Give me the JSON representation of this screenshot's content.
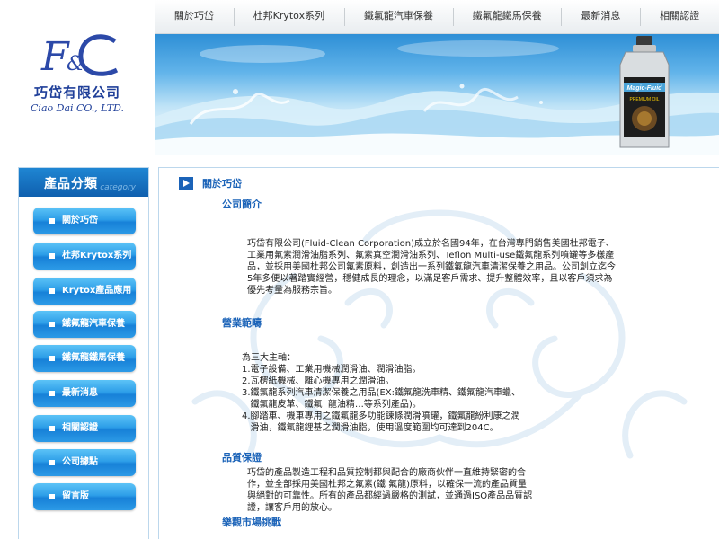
{
  "brand": {
    "logo_text": "F&C",
    "company_name": "巧岱有限公司",
    "company_name_en": "Ciao Dai CO., LTD."
  },
  "top_nav": [
    {
      "label": "關於巧岱"
    },
    {
      "label": "杜邦Krytox系列"
    },
    {
      "label": "鐵氟龍汽車保養"
    },
    {
      "label": "鐵氟龍鐵馬保養"
    },
    {
      "label": "最新消息"
    },
    {
      "label": "相關認證"
    }
  ],
  "banner": {
    "product_label": "Magic-Fluid",
    "product_sub": "PREMIUM OIL"
  },
  "sidebar": {
    "title": "產品分類",
    "subtitle": "category",
    "items": [
      {
        "label": "關於巧岱"
      },
      {
        "label": "杜邦Krytox系列"
      },
      {
        "label": "Krytox產品應用"
      },
      {
        "label": "鐵氟龍汽車保養"
      },
      {
        "label": "鐵氟龍鐵馬保養"
      },
      {
        "label": "最新消息"
      },
      {
        "label": "相關認證"
      },
      {
        "label": "公司據點"
      },
      {
        "label": "留言版"
      }
    ]
  },
  "main": {
    "breadcrumb": "關於巧岱",
    "sections": {
      "intro_title": "公司簡介",
      "intro_lines": [
        "巧岱有限公司(Fluid-Clean Corporation)成立於名國94年，在台灣專門銷售美國杜邦電子、",
        "工業用氟素潤滑油脂系列、氟素真空潤滑油系列、Teflon Multi-use鐵氟龍系列噴罐等多樣產",
        "品，並採用美國杜邦公司氟素原料，創造出一系列鐵氟龍汽車清潔保養之用品。公司創立迄今",
        "5年多便以著踏實經營，穩健成長的理念，以滿足客戶需求、提升整體效率，且以客戶須求為",
        "優先考量為服務宗旨。"
      ],
      "business_title": "營業範疇",
      "business_lines": [
        "為三大主軸：",
        "1.電子設備、工業用機械潤滑油、潤滑油脂。",
        "2.瓦楞紙機械、離心機專用之潤滑油。",
        "3.鐵氟龍系列汽車清潔保養之用品(EX:鐵氟龍洗車精、鐵氟龍汽車蠟、",
        "   鐵氟龍皮革、鐵氟  龍油精…等系列產品)。",
        "4.腳踏車、機車專用之鐵氟龍多功能鍊條潤滑噴罐，鐵氟龍紛利康之潤",
        "   滑油，鐵氟龍鋰基之潤滑油脂，使用溫度範圍均可達到204C。"
      ],
      "quality_title": "品質保證",
      "quality_lines": [
        "巧岱的產品製造工程和品質控制都與配合的廠商伙伴一直維持緊密的合",
        "作，並全部採用美國杜邦之氟素(鐵 氟龍)原料，以確保一流的產品質量",
        "與絕對的可靠性。所有的產品都經過嚴格的測試，並通過ISO產品品質認",
        "證，讓客戶用的放心。"
      ],
      "market_title": "樂觀市場挑戰"
    }
  },
  "colors": {
    "accent_blue": "#1b63b8",
    "sidebar_header": "#1f86d3",
    "button_blue": "#2d9ee8",
    "logo_blue": "#1f3f99"
  }
}
